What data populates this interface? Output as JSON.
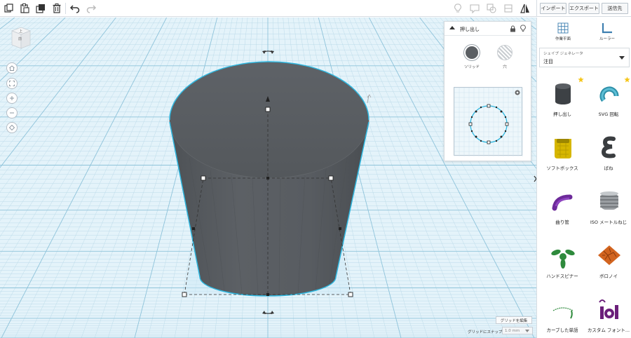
{
  "toolbar": {
    "icons": [
      "copy-icon",
      "paste-icon",
      "duplicate-icon",
      "delete-icon",
      "undo-icon",
      "redo-icon",
      "light-bulb-icon",
      "speech-bubble-icon",
      "group-icon",
      "ungroup-icon",
      "align-icon",
      "mirror-icon"
    ],
    "import_label": "インポート",
    "export_label": "エクスポート",
    "send_label": "送信先"
  },
  "viewcube": {
    "top_label": "上",
    "front_label": "前"
  },
  "nav_icons": [
    "home-icon",
    "fit-icon",
    "zoom-in-icon",
    "zoom-out-icon",
    "perspective-icon"
  ],
  "inspector": {
    "title": "押し出し",
    "solid_label": "ソリッド",
    "hole_label": "穴",
    "solid_color": "#5b5f63"
  },
  "grid": {
    "edit_label": "グリッドを編集",
    "snap_label": "グリッドにスナップ",
    "snap_value": "1.0 mm"
  },
  "sidebar": {
    "workplane_label": "作業平面",
    "ruler_label": "ルーラー",
    "generator_label": "シェイプ ジェネレータ",
    "generator_value": "注目",
    "shapes": [
      {
        "label": "押し出し",
        "icon": "extrude-icon",
        "starred": true
      },
      {
        "label": "SVG 回転",
        "icon": "svg-revolve-icon",
        "starred": true
      },
      {
        "label": "ソフトボックス",
        "icon": "soft-box-icon",
        "starred": false
      },
      {
        "label": "ばね",
        "icon": "spring-icon",
        "starred": false
      },
      {
        "label": "曲り管",
        "icon": "bent-pipe-icon",
        "starred": false
      },
      {
        "label": "ISO メートルねじ",
        "icon": "iso-metric-thread-icon",
        "starred": false
      },
      {
        "label": "ハンドスピナー",
        "icon": "hand-spinner-icon",
        "starred": false
      },
      {
        "label": "ボロノイ",
        "icon": "voronoi-icon",
        "starred": false
      },
      {
        "label": "カーブした単語",
        "icon": "curved-word-icon",
        "starred": false
      },
      {
        "label": "カスタム フォント...",
        "icon": "custom-font-icon",
        "starred": false
      }
    ]
  },
  "colors": {
    "grid_bg": "#e4f3fa",
    "grid_line": "#bcdbe9",
    "grid_major": "#8ec3da",
    "selection": "#2fb6de",
    "shape": "#5b5f63"
  }
}
